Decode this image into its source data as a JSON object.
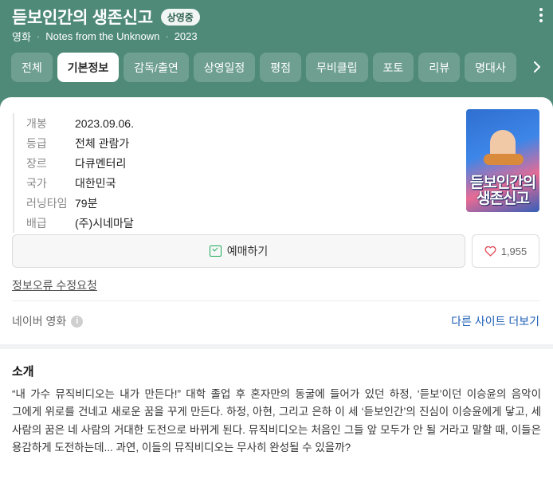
{
  "header": {
    "title": "듣보인간의 생존신고",
    "status_badge": "상영중",
    "meta": [
      "영화",
      "Notes from the Unknown",
      "2023"
    ],
    "bg_color": "#4f8a78"
  },
  "tabs": [
    {
      "label": "전체",
      "active": false
    },
    {
      "label": "기본정보",
      "active": true
    },
    {
      "label": "감독/출연",
      "active": false
    },
    {
      "label": "상영일정",
      "active": false
    },
    {
      "label": "평점",
      "active": false
    },
    {
      "label": "무비클립",
      "active": false
    },
    {
      "label": "포토",
      "active": false
    },
    {
      "label": "리뷰",
      "active": false
    },
    {
      "label": "명대사",
      "active": false
    }
  ],
  "info": [
    {
      "key": "개봉",
      "value": "2023.09.06."
    },
    {
      "key": "등급",
      "value": "전체 관람가"
    },
    {
      "key": "장르",
      "value": "다큐멘터리"
    },
    {
      "key": "국가",
      "value": "대한민국"
    },
    {
      "key": "러닝타임",
      "value": "79분"
    },
    {
      "key": "배급",
      "value": "(주)시네마달"
    }
  ],
  "poster": {
    "title_text": "듣보인간의 생존신고"
  },
  "actions": {
    "reserve_label": "예매하기",
    "like_count": "1,955",
    "accent": "#19ab58"
  },
  "report_link": "정보오류 수정요청",
  "source": {
    "label": "네이버 영화",
    "more_link": "다른 사이트 더보기",
    "link_color": "#1e5fb6"
  },
  "intro": {
    "heading": "소개",
    "text": "“내 가수 뮤직비디오는 내가 만든다!” 대학 졸업 후 혼자만의 동굴에 들어가 있던 하정, ‘듣보’이던 이승윤의 음악이 그에게 위로를 건네고 새로운 꿈을 꾸게 만든다. 하정, 아현, 그리고 은하 이 세 ‘듣보인간’의 진심이 이승윤에게 닿고, 세 사람의 꿈은 네 사람의 거대한 도전으로 바뀌게 된다. 뮤직비디오는 처음인 그들 앞 모두가 안 될 거라고 말할 때, 이들은 용감하게 도전하는데... 과연, 이들의 뮤직비디오는 무사히 완성될 수 있을까?"
  }
}
